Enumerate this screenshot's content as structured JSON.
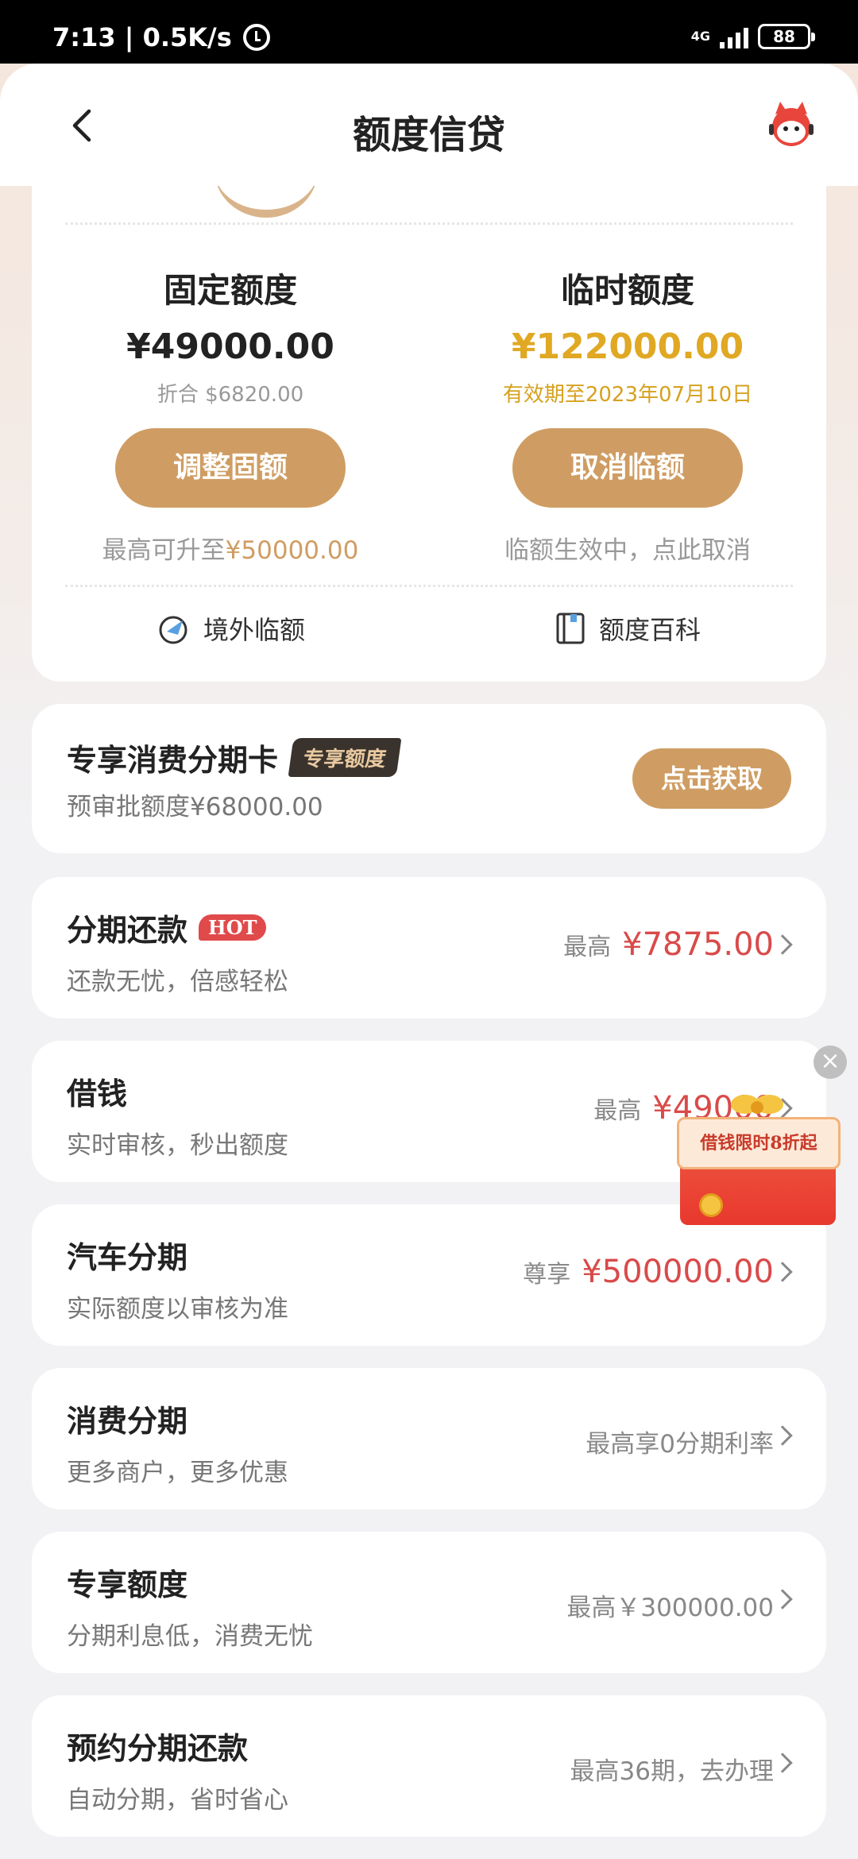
{
  "status_bar": {
    "time_speed": "7:13 | 0.5K/s",
    "network": "4G",
    "battery": "88"
  },
  "header": {
    "title": "额度信贷"
  },
  "credit": {
    "fixed": {
      "title": "固定额度",
      "amount": "¥49000.00",
      "equivalent": "折合 $6820.00",
      "button": "调整固额",
      "note_prefix": "最高可升至",
      "note_value": "¥50000.00"
    },
    "temporary": {
      "title": "临时额度",
      "amount": "¥122000.00",
      "validity": "有效期至2023年07月10日",
      "button": "取消临额",
      "note": "临额生效中，点此取消"
    },
    "tools": {
      "overseas": "境外临额",
      "encyclopedia": "额度百科"
    }
  },
  "exclusive_card": {
    "title": "专享消费分期卡",
    "tag": "专享额度",
    "subtitle": "预审批额度¥68000.00",
    "button": "点击获取"
  },
  "list": [
    {
      "title": "分期还款",
      "badge": "HOT",
      "subtitle": "还款无忧，倍感轻松",
      "prefix": "最高",
      "amount": "¥7875.00"
    },
    {
      "title": "借钱",
      "subtitle": "实时审核，秒出额度",
      "prefix": "最高",
      "amount": "¥49000"
    },
    {
      "title": "汽车分期",
      "subtitle": "实际额度以审核为准",
      "prefix": "尊享",
      "amount": "¥500000.00"
    },
    {
      "title": "消费分期",
      "subtitle": "更多商户，更多优惠",
      "plain": "最高享0分期利率"
    },
    {
      "title": "专享额度",
      "subtitle": "分期利息低，消费无忧",
      "plain": "最高￥300000.00"
    },
    {
      "title": "预约分期还款",
      "subtitle": "自动分期，省时省心",
      "plain": "最高36期，去办理"
    }
  ],
  "promo": {
    "text": "借钱限时8折起",
    "close": "×"
  },
  "colors": {
    "accent": "#cf9d63",
    "gold": "#e0a823",
    "red": "#d94a4a"
  }
}
